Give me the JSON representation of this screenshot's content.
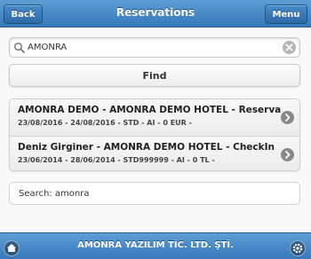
{
  "header": {
    "title": "Reservations",
    "back_label": "Back",
    "menu_label": "Menu"
  },
  "search": {
    "value": "AMONRA",
    "icon": "search-icon",
    "clear_icon": "clear-icon"
  },
  "find_label": "Find",
  "results": [
    {
      "title": "AMONRA DEMO - AMONRA DEMO HOTEL - Reservation",
      "subtitle": "23/08/2016 - 24/08/2016 - STD - AI - 0 EUR -"
    },
    {
      "title": "Deniz Girginer - AMONRA DEMO HOTEL - CheckIn",
      "subtitle": "23/06/2014 - 28/06/2014 - STD999999 - AI - 0 TL -"
    }
  ],
  "summary": "Search: amonra",
  "footer": {
    "title": "AMONRA YAZILIM TİC. LTD. ŞTİ.",
    "home_icon": "home-icon",
    "settings_icon": "gear-icon"
  },
  "colors": {
    "bar": "#4a8bcb",
    "list_bg": "#f1f1f1",
    "chevron": "#888888"
  }
}
